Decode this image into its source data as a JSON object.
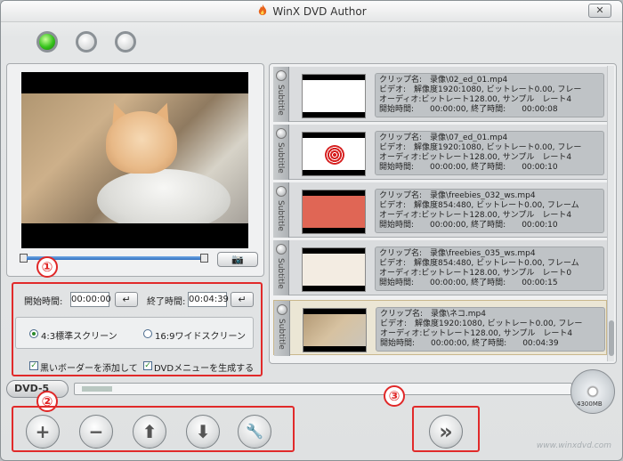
{
  "window": {
    "title": "WinX DVD Author",
    "close_label": "✕",
    "watermark": "www.winxdvd.com"
  },
  "steps": {
    "s1": "①",
    "s2": "②",
    "s3": "③"
  },
  "settings": {
    "start_label": "開始時間:",
    "start_value": "00:00:00",
    "end_label": "終了時間:",
    "end_value": "00:04:39",
    "ok_glyph": "↵",
    "aspect_43": "4:3標準スクリーン",
    "aspect_169": "16:9ワイドスクリーン",
    "black_border": "黒いボーダーを添加して",
    "dvd_menu": "DVDメニューを生成する"
  },
  "clips": [
    {
      "subtitle": "Subtitle",
      "name": "クリップ名:　录像\\02_ed_01.mp4",
      "video": "ビデオ:　解像度1920:1080, ビットレート0.00, フレー",
      "audio": "オーディオ:ビットレート128.00, サンプル　レート4",
      "time": "開始時間:　　00:00:00, 終了時間:　　00:00:08"
    },
    {
      "subtitle": "Subtitle",
      "name": "クリップ名:　录像\\07_ed_01.mp4",
      "video": "ビデオ:　解像度1920:1080, ビットレート0.00, フレー",
      "audio": "オーディオ:ビットレート128.00, サンプル　レート4",
      "time": "開始時間:　　00:00:00, 終了時間:　　00:00:10"
    },
    {
      "subtitle": "Subtitle",
      "name": "クリップ名:　录像\\freebies_032_ws.mp4",
      "video": "ビデオ:　解像度854:480, ビットレート0.00, フレーム",
      "audio": "オーディオ:ビットレート128.00, サンプル　レート4",
      "time": "開始時間:　　00:00:00, 終了時間:　　00:00:10"
    },
    {
      "subtitle": "Subtitle",
      "name": "クリップ名:　录像\\freebies_035_ws.mp4",
      "video": "ビデオ:　解像度854:480, ビットレート0.00, フレーム",
      "audio": "オーディオ:ビットレート128.00, サンプル　レート0",
      "time": "開始時間:　　00:00:00, 終了時間:　　00:00:15"
    },
    {
      "subtitle": "Subtitle",
      "name": "クリップ名:　录像\\ネコ.mp4",
      "video": "ビデオ:　解像度1920:1080, ビットレート0.00, フレー",
      "audio": "オーディオ:ビットレート128.00, サンプル　レート4",
      "time": "開始時間:　　00:00:00, 終了時間:　　00:04:39"
    }
  ],
  "capacity": {
    "dvd_label": "DVD-5",
    "disc_size": "4300MB"
  },
  "toolbar": {
    "add": "+",
    "remove": "−",
    "up": "⬆",
    "down": "⬇",
    "settings": "🔧",
    "next": "»"
  },
  "player": {
    "snapshot_glyph": "📷"
  },
  "colors": {
    "accent_red": "#e12a2a",
    "active_step": "#35c21b",
    "seek_blue": "#2f6fc0"
  }
}
